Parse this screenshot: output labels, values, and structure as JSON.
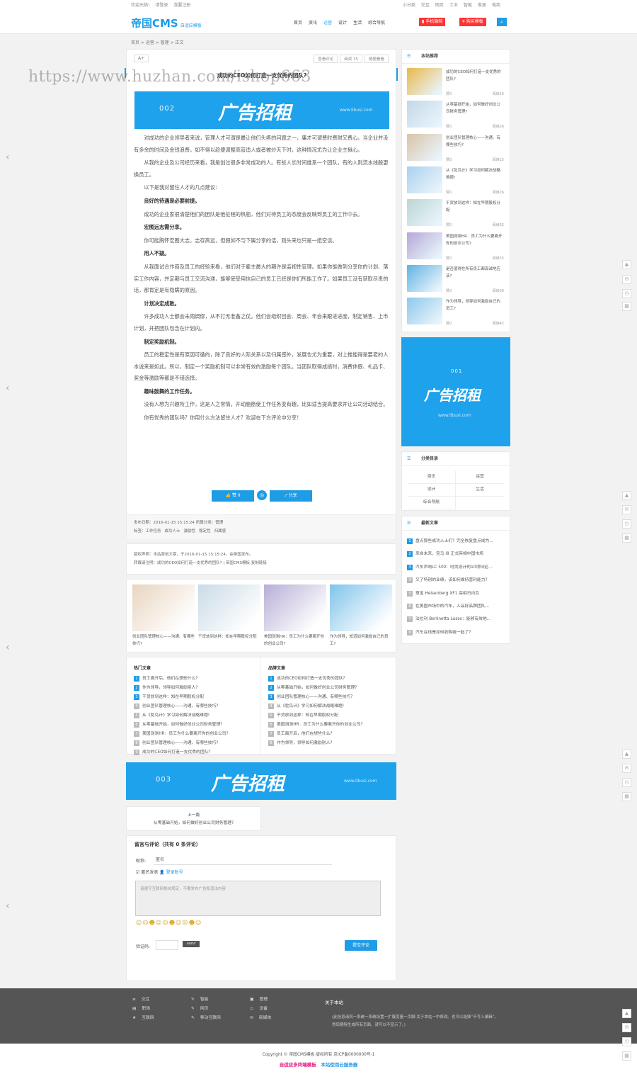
{
  "topbar": {
    "left": [
      "欢迎光临!",
      "请登录",
      "我要注册"
    ],
    "right": [
      "小分类",
      "交互",
      "网页",
      "工业",
      "智能",
      "家居",
      "电商"
    ]
  },
  "logo": {
    "name": "帝国CMS",
    "sub": "自适应模板"
  },
  "nav": {
    "items": [
      "首页",
      "资讯",
      "运营",
      "设计",
      "生活",
      "综合导航"
    ],
    "active": 2,
    "mobile": "手机微网",
    "buy": "购买模板"
  },
  "breadcrumb": "首页 > 运营 > 管理 > 正文",
  "article": {
    "font_btn": "A+",
    "tags_top": [
      "查看评论",
      "阅读 15",
      "随便看看"
    ],
    "title": "成功的CEO如何打造一支优秀的团队?",
    "paragraphs": [
      {
        "t": "对成功的企业领导者来说，管理人才可谓是最让他们头疼的问题之一，庸才可谓费时费财又费心。当企业并没有多余的时间及金钱浪费，如不得以趁便调整高管适人或者被炒天下时，这种情况尤为让企业主揪心。",
        "h": false
      },
      {
        "t": "从我的企业及公司经历来看，我是创过很多非常成功的人。有些人长时间维系一个团队，有的人则流水线般更换员工。",
        "h": false
      },
      {
        "t": "以下是我对留住人才的几点建议：",
        "h": false
      },
      {
        "t": "良好的待遇是必要前提。",
        "h": true
      },
      {
        "t": "成功的企业家很清楚他们的团队是他征程的帆船，他们对待员工的态度会反映到员工的工作中去。",
        "h": false
      },
      {
        "t": "宏图远志需分享。",
        "h": true
      },
      {
        "t": "你可能胸怀宏图大志，志存高远，但假如不与下属分享的话，则头来也只是一纸空谈。",
        "h": false
      },
      {
        "t": "用人不疑。",
        "h": true
      },
      {
        "t": "从我面试合作商及员工的经验来看，他们对于雇主最大的期许是监视性管理。如果你能做到分享你的计划、落实工作内容，并定期与员工交流沟通，能够使受用信自己的员工已经是你们所能工作了。如果员工没有获取尽责的话，那肯定是有隐瞒的原因。",
        "h": false
      },
      {
        "t": "计划决定成败。",
        "h": true
      },
      {
        "t": "许多成功人士都会未雨绸缪，从不打无准备之仗。他们会组织回会、周会、年会来跟进进度，制定销售、上市计划，并把团队包含在计划内。",
        "h": false
      },
      {
        "t": "制定奖励机制。",
        "h": true
      },
      {
        "t": "员工的稳定性是有原因可循的，除了良好的人际关系以及归属感外，发展也尤为重要，对上推能得是要老的人本说来是如此。所以，制定一个奖励机制可以非常有效的激励每个团队。当团队取得成绩时，消费休假、礼品卡、奖金等激励等都是不错选择。",
        "h": false
      },
      {
        "t": "趣味鼓舞的工作任务。",
        "h": true
      },
      {
        "t": "没有人想为兴趣所工作，这是人之常情。开动脑筋使工作任务变有趣，比如适当提高要求并让公司活动结合。",
        "h": false
      },
      {
        "t": "你有优秀的团队吗？你用什么方法留住人才？欢迎在下方评论中分享！",
        "h": false
      }
    ],
    "like": "赞 0",
    "share": "分享",
    "meta": {
      "date_label": "发布日期：",
      "date": "2016-01-15 15:15:24",
      "cat_label": "所属分类：",
      "cat": "管理",
      "tags_label": "标签：",
      "tags": [
        "工作任务",
        "成功人士",
        "激励性",
        "稳定性",
        "归属感"
      ]
    },
    "copyright": {
      "l1_label": "版权声明：",
      "l1": "本站原创文章，于2016-01-15 15:15:24，由帝国发布。",
      "l2_label": "转载请注明：",
      "l2": "成功的CEO如何打造一支优秀的团队? | 帝国CMS模板",
      "l2_link": "复制链接"
    }
  },
  "related": [
    {
      "t": "创业团队管理核心——沟通、有哪些技巧?",
      "c": "#e8d5c0"
    },
    {
      "t": "干货放到这样：知在早期股权分配",
      "c": "#c9dbe6"
    },
    {
      "t": "美国测测HR：员工为什么要离开你的创业公司?",
      "c": "#b7aed6"
    },
    {
      "t": "作为领导，知道如何激励自己的员工?",
      "c": "#7fc3ea"
    }
  ],
  "hot": {
    "title": "热门文章",
    "items": [
      "员工离开后，他们在想些什么?",
      "作为领导，领导如何激励别人?",
      "干货放到这样：知在早期股权分配",
      "创业团队管理核心——沟通、有哪些技巧?",
      "从《鸵鸟计》学习如何解决战略难题!",
      "从零基础开始，如何做好创业公司财务管理?",
      "美国测测HR：员工为什么要离开你的创业公司?",
      "创业团队管理核心——沟通、有哪些技巧?",
      "成功的CEO如何打造一支优秀的团队?"
    ]
  },
  "best": {
    "title": "品牌文章",
    "items": [
      "成功的CEO如何打造一支优秀的团队?",
      "从零基础开始，如何做好创业公司财务管理?",
      "创业团队管理核心——沟通、有哪些技巧?",
      "从《鸵鸟计》学习如何解决战略难题!",
      "干货放到这样：知在早期股权分配",
      "美国测测HR：员工为什么要离开你的创业公司?",
      "员工离开后，他们在想些什么?",
      "作为领导，领导如何激励别人?"
    ]
  },
  "ads": {
    "num1": "002",
    "num2": "001",
    "num3": "003",
    "text": "广告招租",
    "url": "www.libusi.com"
  },
  "prev": {
    "label": "上一篇",
    "title": "从零基础开始，如何做好创业公司财务管理?"
  },
  "comment": {
    "title": "留言与评论（共有 0 条评论）",
    "nick_label": "昵称:",
    "nick": "匿名",
    "anon": "匿名发表",
    "login": "登录账号",
    "placeholder": "请遵守互联网相关规定，不要发布广告和违法内容",
    "emoji": "☺☹☻☺☹☻☺☹☻☺",
    "code_label": "验证码:",
    "code": "uurvl",
    "submit": "提交评论"
  },
  "side": {
    "rec_title": "本站推荐",
    "rec": [
      {
        "t": "成功的CEO如何打造一支优秀的团队?",
        "r": "阅读16",
        "c": "#e8b84a"
      },
      {
        "t": "从零基础开始，如何做好创业公司财务管理?",
        "r": "阅读26",
        "c": "#c2d8e8"
      },
      {
        "t": "创业团队管理核心——沟通、有哪些技巧?",
        "r": "阅读15",
        "c": "#d9c3a8"
      },
      {
        "t": "从《鸵鸟计》学习如何解决战略难题!",
        "r": "阅读26",
        "c": "#a9d0ee"
      },
      {
        "t": "干货放到这样：知在早期股权分配",
        "r": "阅读32",
        "c": "#bcd6d2"
      },
      {
        "t": "美国测测HR：员工为什么要离开你的创业公司?",
        "r": "阅读15",
        "c": "#b3a8d8"
      },
      {
        "t": "是否值得在所有员工都真诚地应该?",
        "r": "阅读39",
        "c": "#5fb2e4"
      },
      {
        "t": "作为领导，领导如何激励自己的员工?",
        "r": "阅读42",
        "c": "#8cc8ec"
      }
    ],
    "like": "赞0",
    "cat_title": "分类目录",
    "cats": [
      "资讯",
      "运营",
      "设计",
      "生活",
      "综合导航"
    ],
    "latest_title": "最新文章",
    "latest": [
      "盘点那些成功人士们？完全恢复盘点成为...",
      "来自未来，宝马 i8 正式亮相中国市场",
      "汽车声响LC 500：时尚设计的10项特征...",
      "又了特别的业绩，该如何维持营利能力?",
      "尊宝 Helsenberg XF1 亮相日内瓦",
      "在美国市场中的汽车，人品好品牌团队...",
      "法拉利 Berlinetta Lusso：能够有效地...",
      "汽车在线是如何收购组一起了?"
    ]
  },
  "footer": {
    "col1": [
      "交互",
      "职场",
      "互联网"
    ],
    "col2": [
      "智能",
      "网页",
      "移动互联网"
    ],
    "col3": [
      "管理",
      "设备",
      "新媒体"
    ],
    "about_title": "关于本站",
    "about": "(此信息请到一系统一系统设置一扩展变量一页脚·关于本站一中修改。也可以选择“不写入编辑”，然后删除生成所有页面，就可以不显示了。)",
    "copyright": "Copyright © 帝国CMS模板 版权所有 京ICP备0000000号-1",
    "link1": "自适应多终端模板",
    "link2": "本站使用云服务器"
  },
  "watermark": "https://www.huzhan.com/ishop663",
  "colors": {
    "accent": "#1e9ce6",
    "red": "#ff3333",
    "footer": "#555555"
  }
}
